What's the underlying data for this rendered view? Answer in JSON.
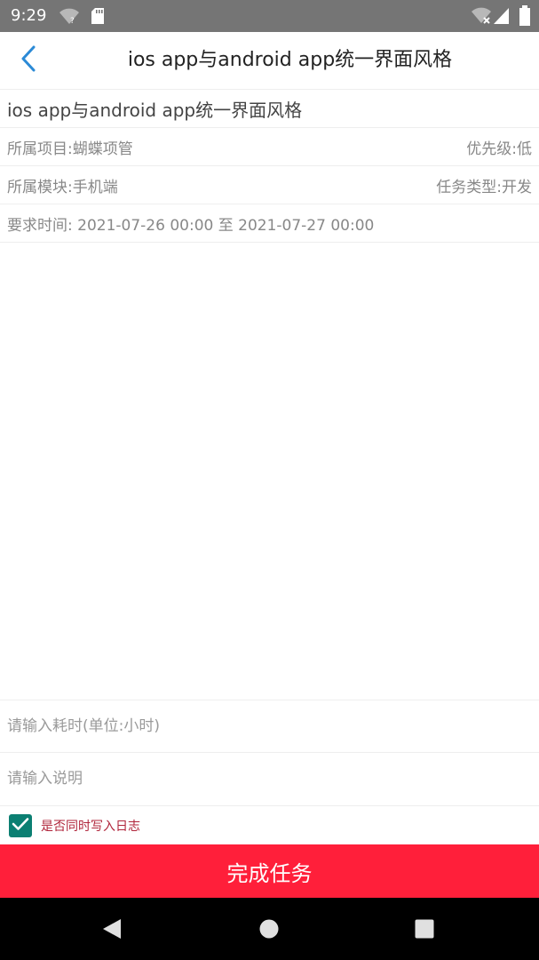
{
  "status_bar": {
    "time": "9:29",
    "icons": [
      "wifi-question-icon",
      "sd-card-icon",
      "wifi-off-icon",
      "cell-signal-icon",
      "battery-icon"
    ]
  },
  "header": {
    "title": "ios app与android app统一界面风格",
    "back_icon": "chevron-left-icon",
    "accent_color": "#2b8ad6"
  },
  "task": {
    "name": "ios app与android app统一界面风格",
    "project": "所属项目:蝴蝶项管",
    "priority": "优先级:低",
    "module": "所属模块:手机端",
    "task_type": "任务类型:开发",
    "required_time": "要求时间: 2021-07-26 00:00 至 2021-07-27 00:00"
  },
  "form": {
    "hours_placeholder": "请输入耗时(单位:小时)",
    "hours_value": "",
    "description_placeholder": "请输入说明",
    "description_value": "",
    "write_log_label": "是否同时写入日志",
    "write_log_checked": true,
    "checkbox_color": "#0b7f72"
  },
  "actions": {
    "complete_label": "完成任务",
    "complete_color": "#ff1f3a"
  },
  "nav_bar": {
    "icons": [
      "nav-back-icon",
      "nav-home-icon",
      "nav-recents-icon"
    ]
  }
}
